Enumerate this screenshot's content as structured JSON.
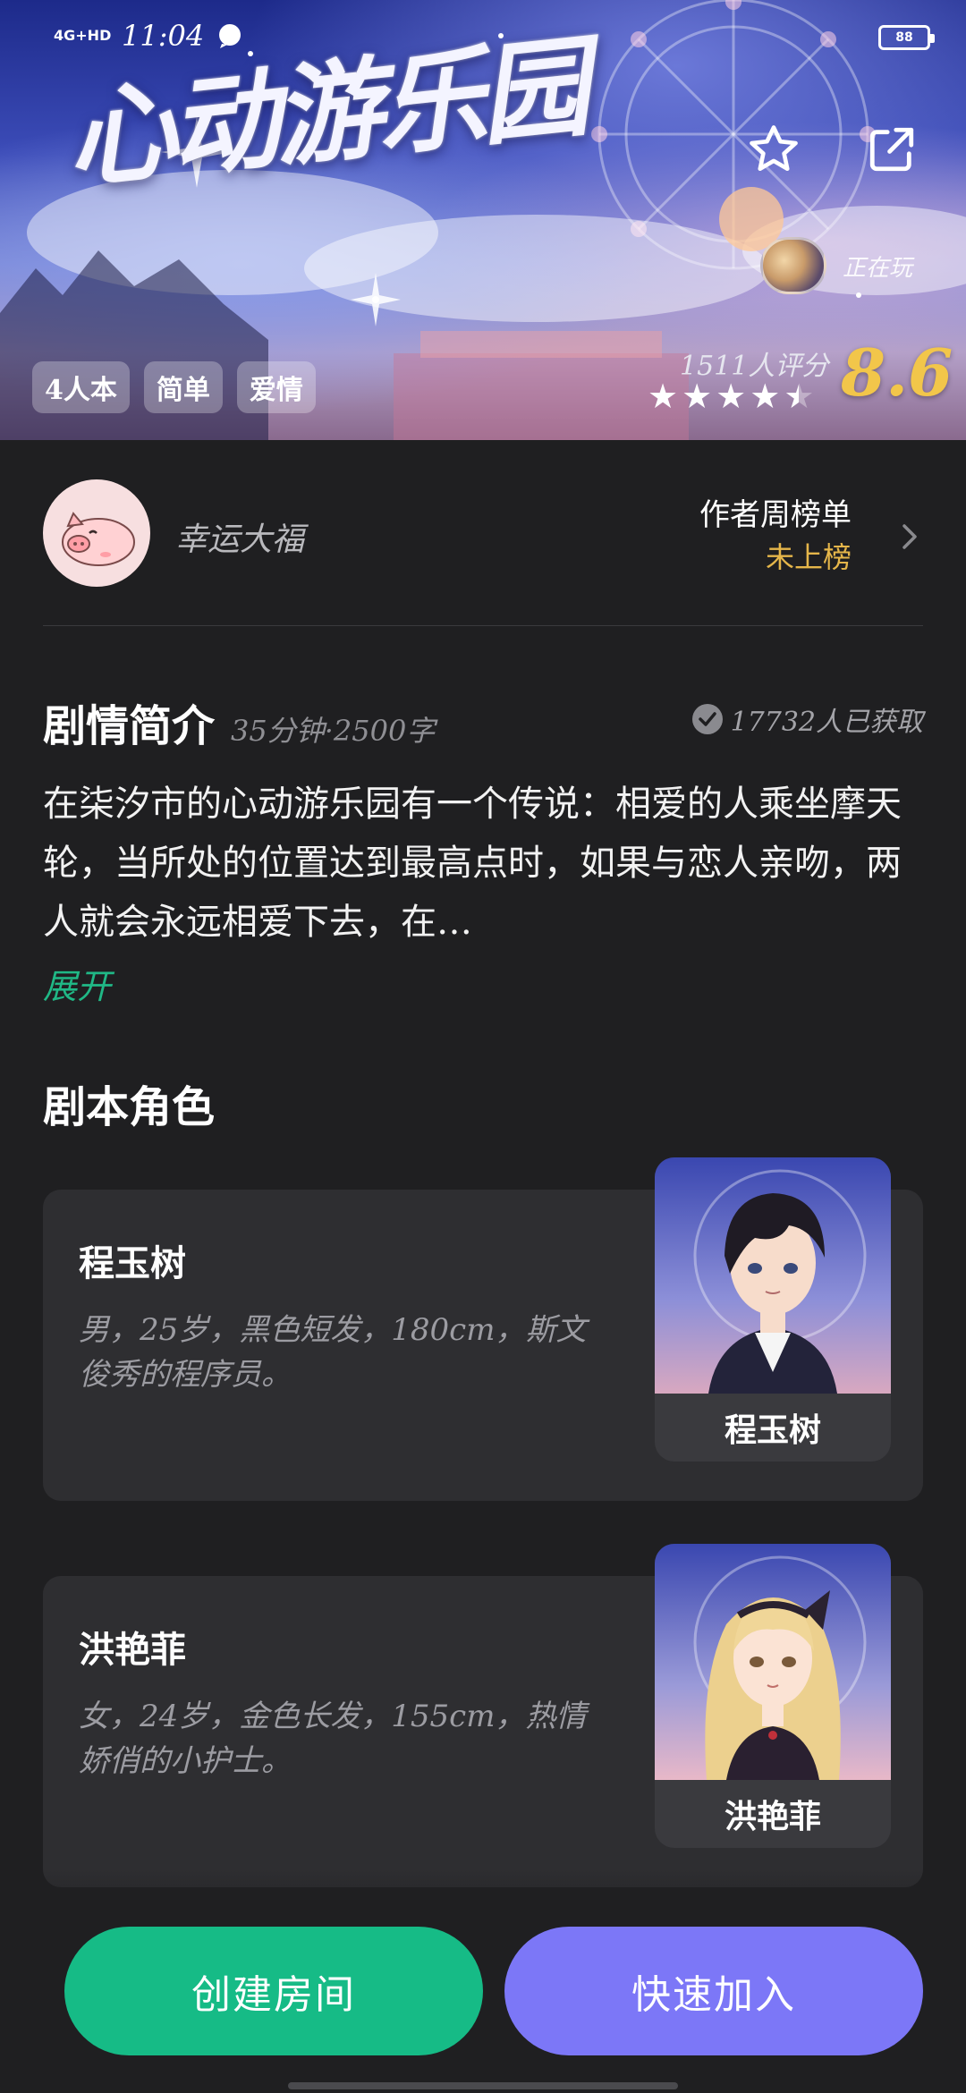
{
  "status_bar": {
    "network": "4G+HD",
    "time": "11:04",
    "battery": "88"
  },
  "hero": {
    "title": "心动游乐园",
    "playing_label": "正在玩",
    "tags": [
      "4人本",
      "简单",
      "爱情"
    ],
    "rating_count": "1511人评分",
    "score": "8.6",
    "stars": 4.5
  },
  "author": {
    "name": "幸运大福",
    "rank_title": "作者周榜单",
    "rank_value": "未上榜"
  },
  "synopsis": {
    "title": "剧情简介",
    "meta": "35分钟·2500字",
    "obtained": "17732人已获取",
    "body": "在柒汐市的心动游乐园有一个传说：相爱的人乘坐摩天轮，当所处的位置达到最高点时，如果与恋人亲吻，两人就会永远相爱下去，在…",
    "expand": "展开"
  },
  "roles": {
    "title": "剧本角色",
    "items": [
      {
        "name": "程玉树",
        "desc": "男，25岁，黑色短发，180cm，斯文俊秀的程序员。"
      },
      {
        "name": "洪艳菲",
        "desc": "女，24岁，金色长发，155cm，热情娇俏的小护士。"
      }
    ]
  },
  "actions": {
    "create": "创建房间",
    "join": "快速加入"
  },
  "colors": {
    "background": "#1f1f21",
    "card": "#2e2e31",
    "accent_green": "#16bb86",
    "accent_purple": "#7c77f7",
    "score_gold": "#f2c64a",
    "rank_gold": "#e5b64a",
    "link_green": "#20b886"
  },
  "icons": [
    "message-icon",
    "battery-icon",
    "star-outline-icon",
    "share-icon",
    "chevron-right-icon",
    "check-circle-icon"
  ]
}
